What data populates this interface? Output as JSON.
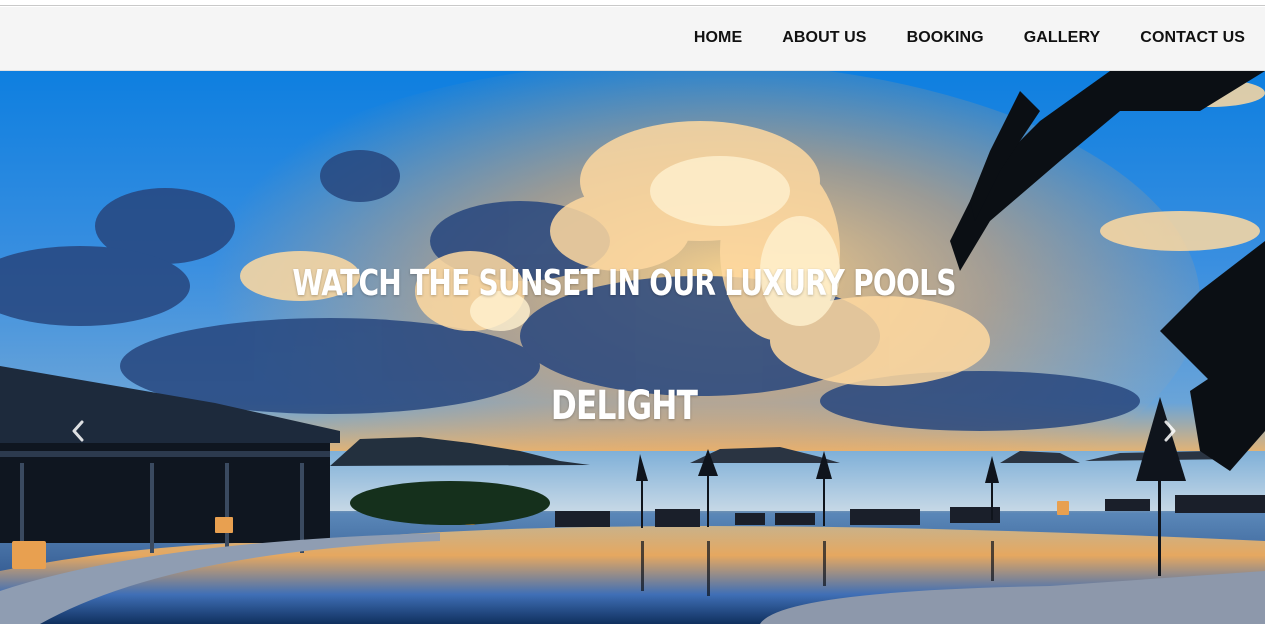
{
  "nav": {
    "items": [
      {
        "label": "HOME"
      },
      {
        "label": "ABOUT US"
      },
      {
        "label": "BOOKING"
      },
      {
        "label": "GALLERY"
      },
      {
        "label": "CONTACT US"
      }
    ]
  },
  "hero": {
    "title": "WATCH THE SUNSET IN OUR LUXURY POOLS",
    "subtitle": "DELIGHT",
    "prev_icon": "chevron-left-icon",
    "next_icon": "chevron-right-icon"
  },
  "colors": {
    "navbar_bg": "#f5f5f5",
    "nav_text": "#111111",
    "caption_text": "#ffffff"
  }
}
